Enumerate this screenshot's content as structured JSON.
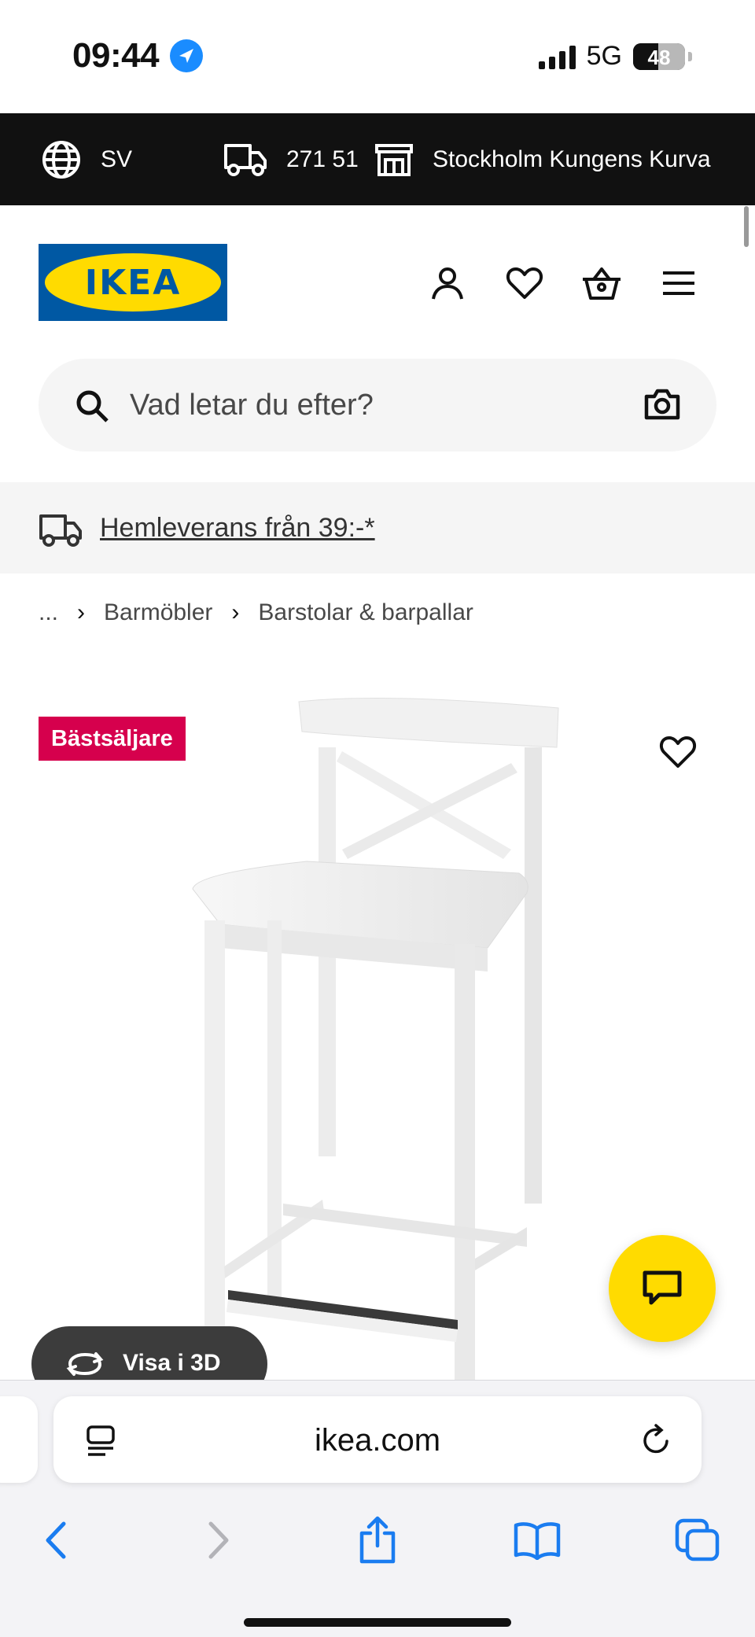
{
  "status_bar": {
    "time": "09:44",
    "network": "5G",
    "battery": "48"
  },
  "top_bar": {
    "language": "SV",
    "postcode": "271 51",
    "store": "Stockholm Kungens Kurva"
  },
  "header": {
    "logo_text": "IKEA"
  },
  "search": {
    "placeholder": "Vad letar du efter?"
  },
  "promo": {
    "text": "Hemleverans från 39:-*"
  },
  "breadcrumb": {
    "items": [
      "...",
      "Barmöbler",
      "Barstolar & barpallar"
    ]
  },
  "product": {
    "badge": "Bästsäljare",
    "view_3d_label": "Visa i 3D"
  },
  "browser": {
    "url": "ikea.com"
  },
  "colors": {
    "ikea_blue": "#0058a3",
    "ikea_yellow": "#ffdb00",
    "badge_red": "#d6004d",
    "top_bar_bg": "#111111",
    "safari_blue": "#1a7cf0"
  },
  "icons": [
    "location-arrow-icon",
    "globe-icon",
    "truck-icon",
    "store-icon",
    "account-icon",
    "heart-icon",
    "basket-icon",
    "menu-icon",
    "search-icon",
    "camera-icon",
    "chat-icon",
    "rotate-3d-icon",
    "reader-icon",
    "reload-icon",
    "back-icon",
    "forward-icon",
    "share-icon",
    "bookmarks-icon",
    "tabs-icon"
  ]
}
